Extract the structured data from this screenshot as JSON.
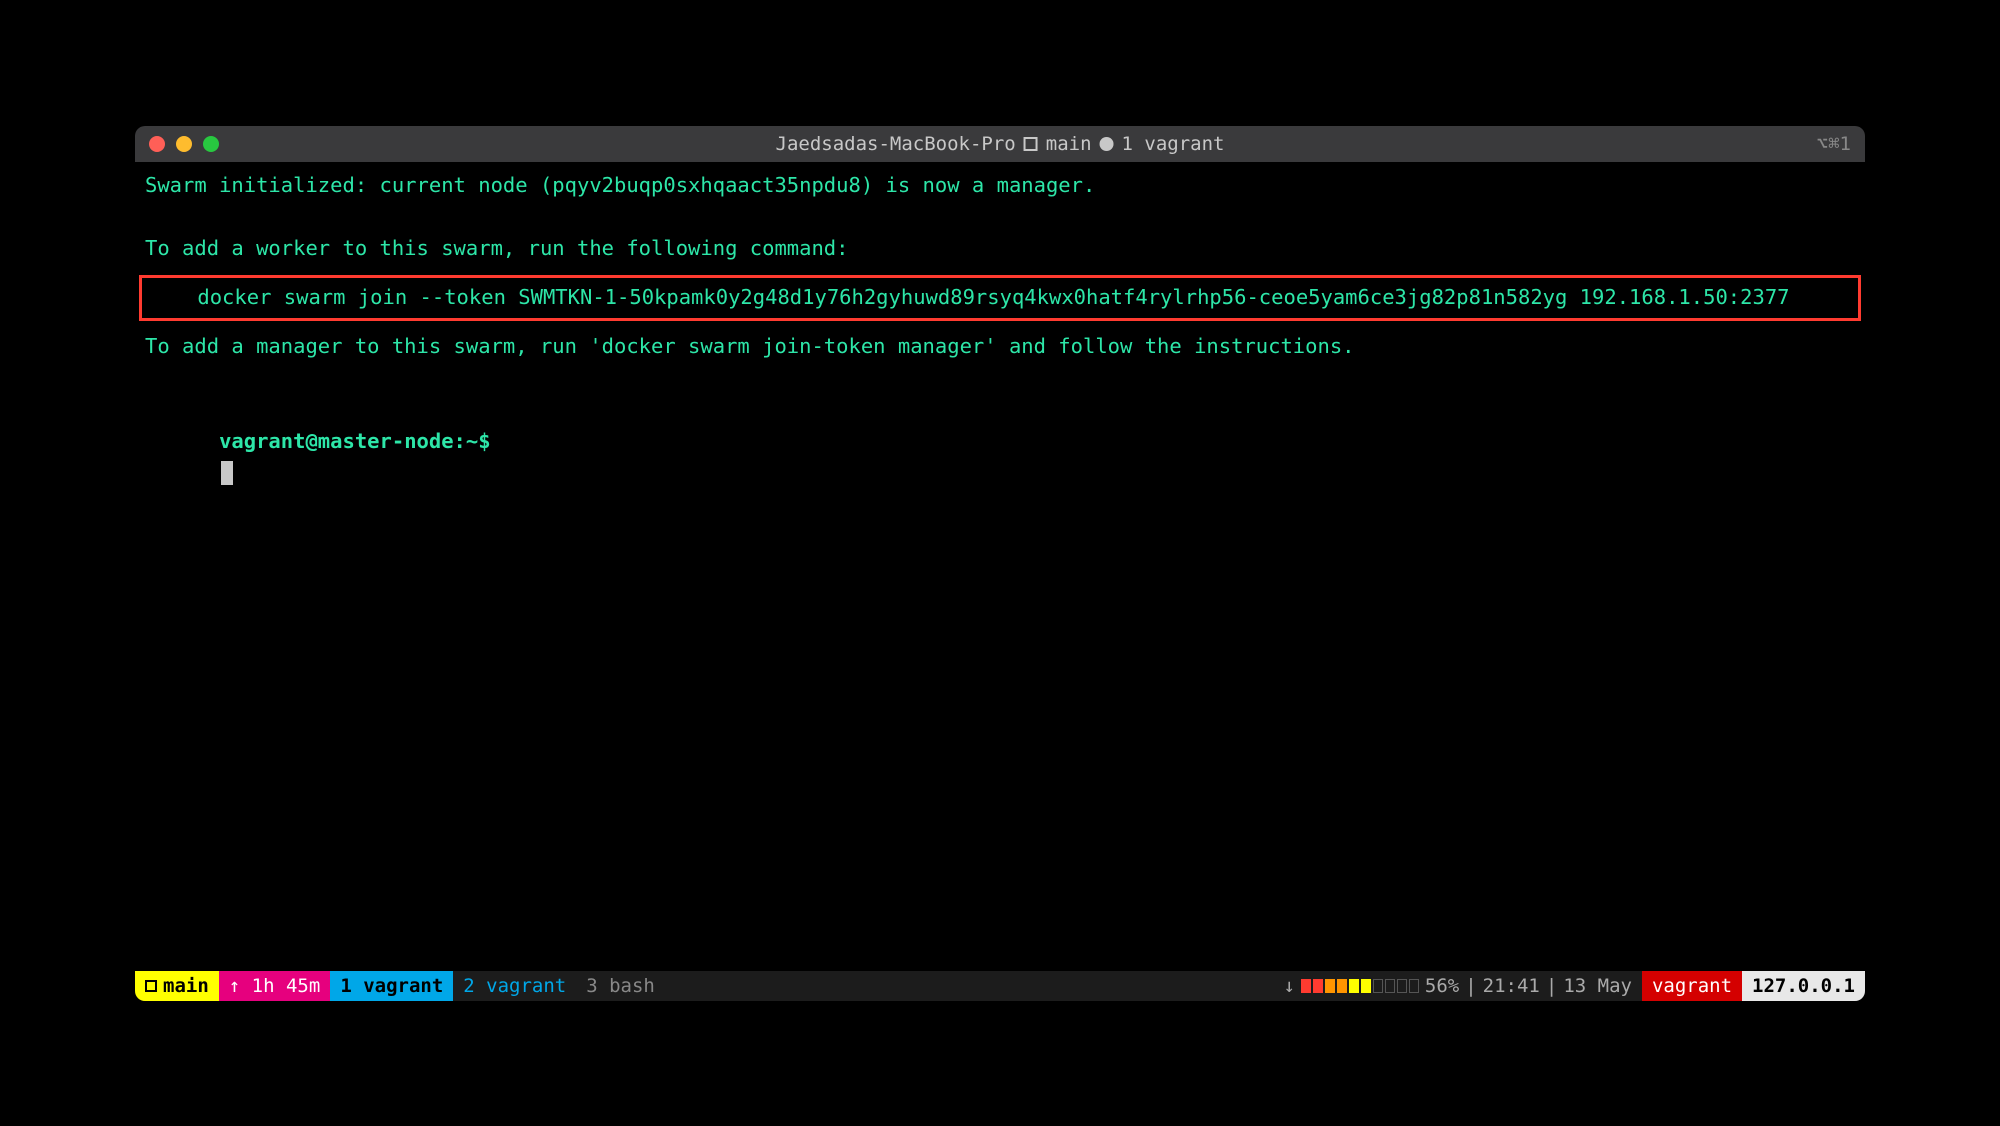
{
  "titlebar": {
    "hostname": "Jaedsadas-MacBook-Pro",
    "session": "main",
    "window_label": "1 vagrant",
    "shortcut_hint": "⌥⌘1"
  },
  "terminal": {
    "line1": "Swarm initialized: current node (pqyv2buqp0sxhqaact35npdu8) is now a manager.",
    "line2": "To add a worker to this swarm, run the following command:",
    "join_cmd": "    docker swarm join --token SWMTKN-1-50kpamk0y2g48d1y76h2gyhuwd89rsyq4kwx0hatf4rylrhp56-ceoe5yam6ce3jg82p81n582yg 192.168.1.50:2377",
    "line3": "To add a manager to this swarm, run 'docker swarm join-token manager' and follow the instructions.",
    "prompt": "vagrant@master-node:~$"
  },
  "statusbar": {
    "session": "main",
    "uptime_prefix": "↑",
    "uptime": "1h 45m",
    "win1": "1 vagrant",
    "win2": "2 vagrant",
    "win3": "3 bash",
    "arrow": "↓",
    "battery_pct": "56%",
    "time": "21:41",
    "date": "13 May",
    "user": "vagrant",
    "ip": "127.0.0.1",
    "sep": "|"
  }
}
